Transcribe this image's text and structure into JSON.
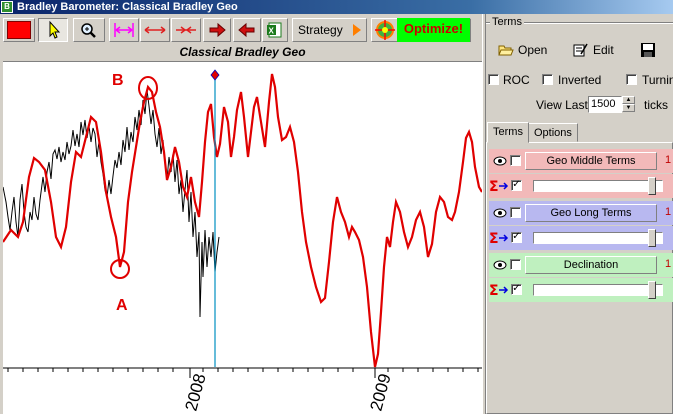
{
  "window": {
    "title": "Bradley Barometer: Classical Bradley Geo"
  },
  "toolbar": {
    "strategy_label": "Strategy",
    "optimize_label": "Optimize!",
    "colors": {
      "record": "#ff0000",
      "optimize_bg": "#00ff00",
      "optimize_text": "#cc0000"
    }
  },
  "chart": {
    "title": "Classical Bradley Geo",
    "annotations": {
      "a": "A",
      "b": "B"
    },
    "x_labels": [
      "2008",
      "2009"
    ]
  },
  "terms_panel": {
    "group_label": "Terms",
    "open_label": "Open",
    "edit_label": "Edit",
    "checkboxes": [
      {
        "label": "ROC",
        "checked": false
      },
      {
        "label": "Inverted",
        "checked": false
      },
      {
        "label": "Turning",
        "checked": false
      }
    ],
    "view_last_label": "View Last",
    "view_last_value": "1500",
    "ticks_label": "ticks",
    "tabs": [
      "Terms",
      "Options"
    ],
    "active_tab": "Terms",
    "terms": [
      {
        "name": "Geo Middle Terms",
        "visible": false,
        "enabled": true,
        "color": "#f2b9b9",
        "num": "1"
      },
      {
        "name": "Geo Long Terms",
        "visible": false,
        "enabled": true,
        "color": "#b8b8f0",
        "num": "1"
      },
      {
        "name": "Declination",
        "visible": false,
        "enabled": true,
        "color": "#bff0bf",
        "num": "1"
      }
    ]
  }
}
